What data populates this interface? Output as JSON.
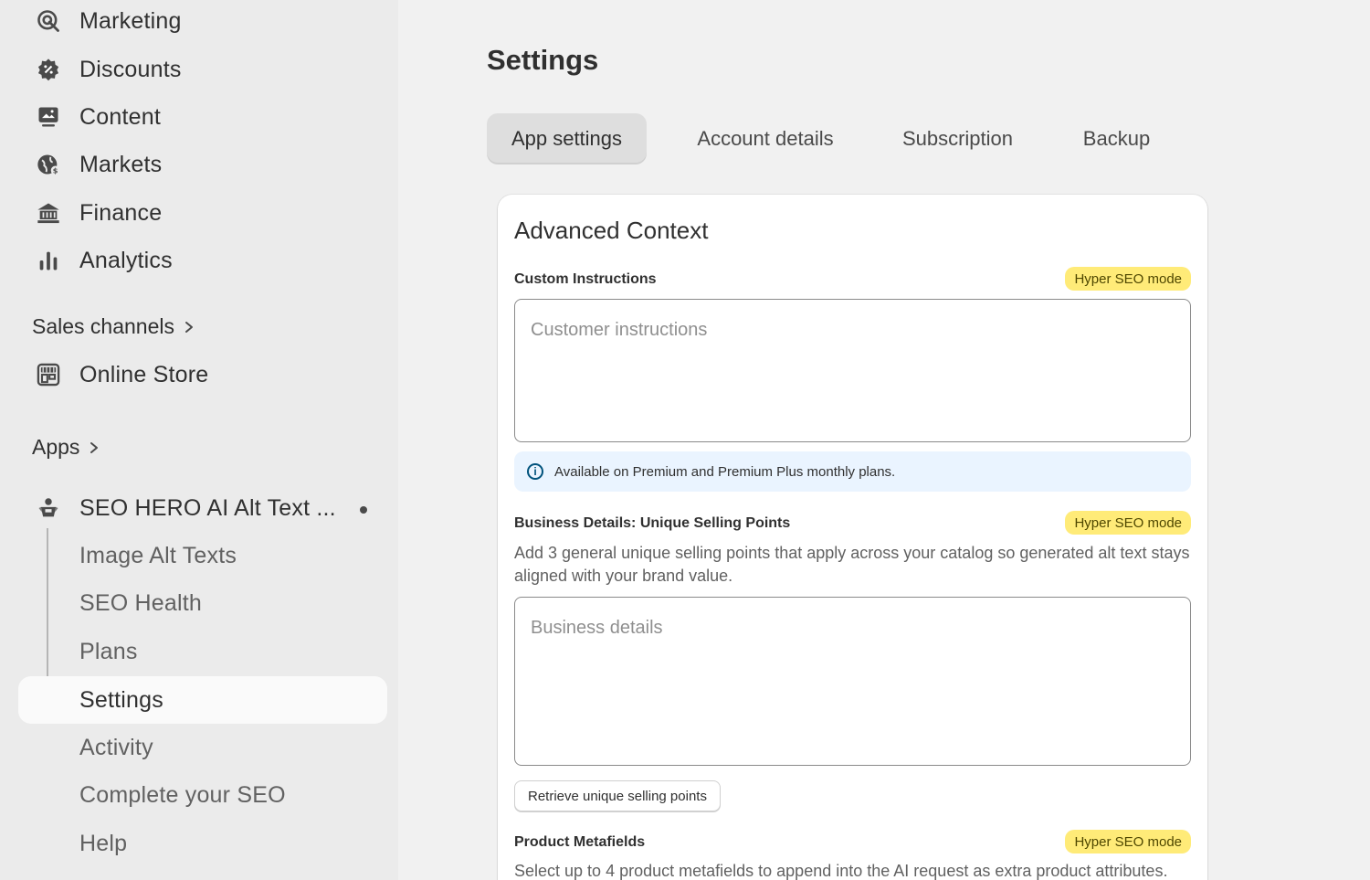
{
  "sidebar": {
    "items": [
      {
        "label": "Marketing",
        "icon": "marketing-icon"
      },
      {
        "label": "Discounts",
        "icon": "discounts-icon"
      },
      {
        "label": "Content",
        "icon": "content-icon"
      },
      {
        "label": "Markets",
        "icon": "markets-icon"
      },
      {
        "label": "Finance",
        "icon": "finance-icon"
      },
      {
        "label": "Analytics",
        "icon": "analytics-icon"
      }
    ],
    "sales_channels": {
      "label": "Sales channels",
      "items": [
        {
          "label": "Online Store",
          "icon": "online-store-icon"
        }
      ]
    },
    "apps": {
      "label": "Apps",
      "app_name": "SEO HERO AI Alt Text ...",
      "sub_items": [
        {
          "label": "Image Alt Texts"
        },
        {
          "label": "SEO Health"
        },
        {
          "label": "Plans"
        },
        {
          "label": "Settings",
          "active": true
        },
        {
          "label": "Activity"
        },
        {
          "label": "Complete your SEO"
        },
        {
          "label": "Help"
        }
      ]
    }
  },
  "main": {
    "title": "Settings",
    "tabs": [
      {
        "label": "App settings",
        "active": true
      },
      {
        "label": "Account details"
      },
      {
        "label": "Subscription"
      },
      {
        "label": "Backup"
      }
    ],
    "card": {
      "title": "Advanced Context",
      "badge_label": "Hyper SEO mode",
      "custom_instructions": {
        "label": "Custom Instructions",
        "placeholder": "Customer instructions",
        "value": ""
      },
      "banner": "Available on Premium and Premium Plus monthly plans.",
      "business_details": {
        "label": "Business Details: Unique Selling Points",
        "help": "Add 3 general unique selling points that apply across your catalog so generated alt text stays aligned with your brand value.",
        "placeholder": "Business details",
        "value": "",
        "button": "Retrieve unique selling points"
      },
      "product_metafields": {
        "label": "Product Metafields",
        "help": "Select up to 4 product metafields to append into the AI request as extra product attributes."
      }
    }
  },
  "colors": {
    "badge_bg": "#ffeb78",
    "banner_bg": "#eaf4ff",
    "sidebar_bg": "#ebebeb",
    "page_bg": "#f1f1f1"
  }
}
